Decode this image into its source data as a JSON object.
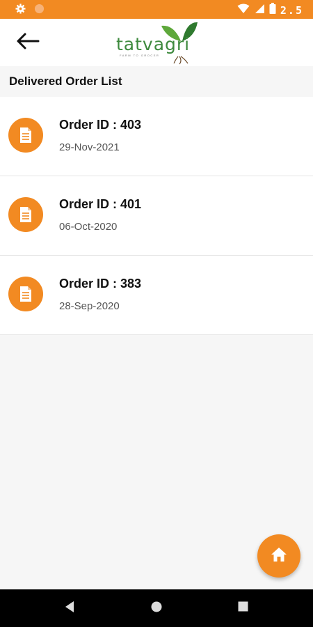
{
  "status_bar": {
    "time": "2.5",
    "icons": [
      "settings-icon",
      "circle-icon",
      "wifi-icon",
      "signal-icon",
      "battery-icon"
    ]
  },
  "app_bar": {
    "logo_text": "tatvagri",
    "logo_tagline": "FARM TO GROCER",
    "back_icon": "arrow-left-icon"
  },
  "section": {
    "title": "Delivered Order List"
  },
  "orders": [
    {
      "id_label": "Order ID : 403",
      "date": "29-Nov-2021",
      "icon": "document-icon"
    },
    {
      "id_label": "Order ID : 401",
      "date": "06-Oct-2020",
      "icon": "document-icon"
    },
    {
      "id_label": "Order ID : 383",
      "date": "28-Sep-2020",
      "icon": "document-icon"
    }
  ],
  "fab": {
    "icon": "home-icon"
  },
  "nav": {
    "icons": [
      "back-triangle-icon",
      "home-circle-icon",
      "recents-square-icon"
    ]
  },
  "colors": {
    "accent": "#f28a22",
    "brand_green": "#3e8a3e",
    "background": "#f6f6f6"
  }
}
